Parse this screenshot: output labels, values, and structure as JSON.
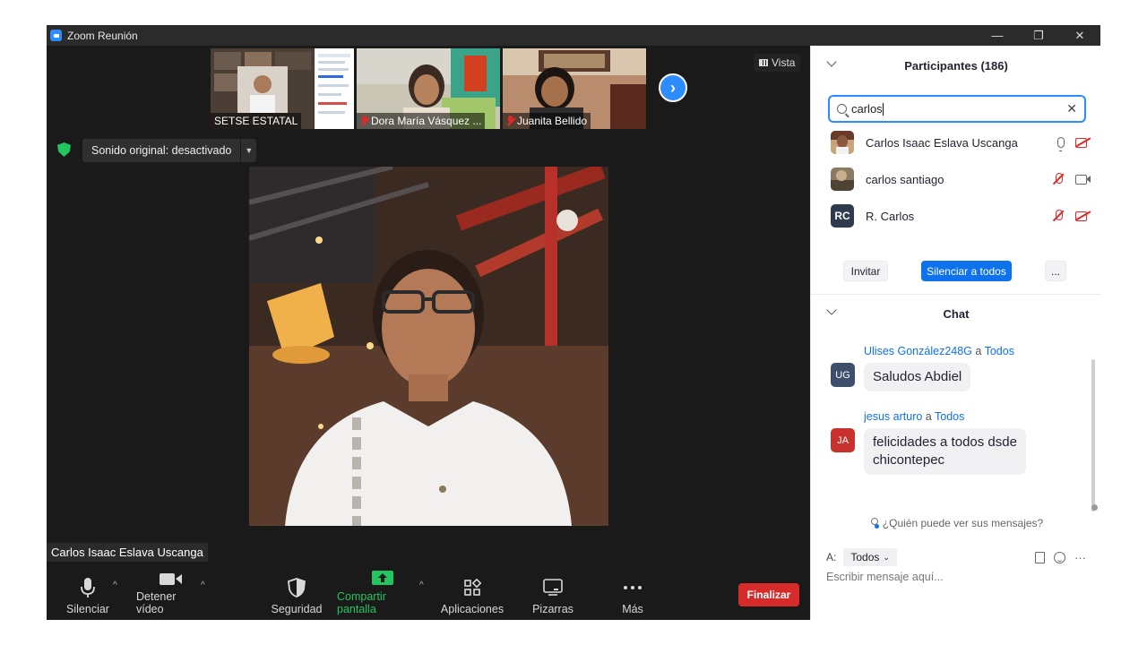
{
  "window": {
    "title": "Zoom Reunión",
    "controls": [
      "—",
      "❐",
      "✕"
    ]
  },
  "stage": {
    "thumbnails": [
      {
        "name": "SETSE ESTATAL",
        "muted": false
      },
      {
        "name": "Dora María Vásquez ...",
        "muted": true
      },
      {
        "name": "Juanita Bellido",
        "muted": true
      }
    ],
    "view_button": "Vista",
    "audio_pill": "Sonido original: desactivado",
    "active_speaker": "Carlos Isaac Eslava Uscanga"
  },
  "toolbar": {
    "mute": "Silenciar",
    "stop_video": "Detener vídeo",
    "security": "Seguridad",
    "share": "Compartir pantalla",
    "apps": "Aplicaciones",
    "whiteboards": "Pizarras",
    "more": "Más",
    "end": "Finalizar"
  },
  "participants": {
    "header": "Participantes (186)",
    "search_value": "carlos",
    "list": [
      {
        "name": "Carlos Isaac Eslava Uscanga",
        "mic": "on",
        "video": "off"
      },
      {
        "name": "carlos santiago",
        "mic": "off",
        "video": "on"
      },
      {
        "name": "R. Carlos",
        "initials": "RC",
        "mic": "off",
        "video": "off"
      }
    ],
    "invite": "Invitar",
    "mute_all": "Silenciar a todos",
    "more": "..."
  },
  "chat": {
    "header": "Chat",
    "messages": [
      {
        "from": "Ulises González248G",
        "to_word": "a",
        "to": "Todos",
        "initials": "UG",
        "avatar_color": "#3d4f6b",
        "lines": [
          "Saludos Abdiel"
        ]
      },
      {
        "from": "jesus arturo",
        "to_word": "a",
        "to": "Todos",
        "initials": "JA",
        "avatar_color": "#c9312c",
        "lines": [
          "felicidades a todos dsde",
          "chicontepec"
        ]
      }
    ],
    "who_can_see": "¿Quién puede ver sus mensajes?",
    "to_label": "A:",
    "to_value": "Todos",
    "placeholder": "Escribir mensaje aquí..."
  },
  "colors": {
    "accent": "#2d8cff",
    "end_button": "#d62b2b",
    "share_green": "#23c55e"
  }
}
